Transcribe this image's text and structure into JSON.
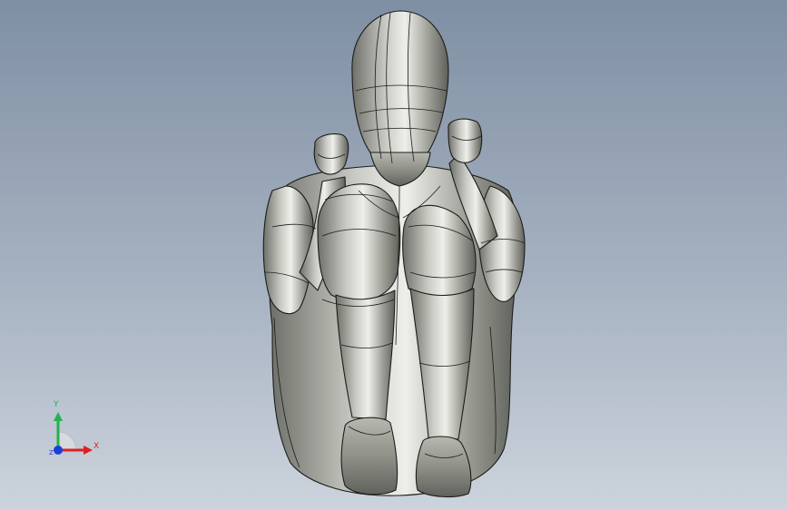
{
  "viewport": {
    "background_top": "#7f8fa3",
    "background_bottom": "#ccd3dc",
    "model_color": "#a9aba3",
    "edge_color": "#1c1d1b"
  },
  "triad": {
    "x_label": "X",
    "y_label": "Y",
    "z_label": "Z",
    "x_color": "#e02020",
    "y_color": "#22b24c",
    "z_color": "#1a3fd6"
  }
}
